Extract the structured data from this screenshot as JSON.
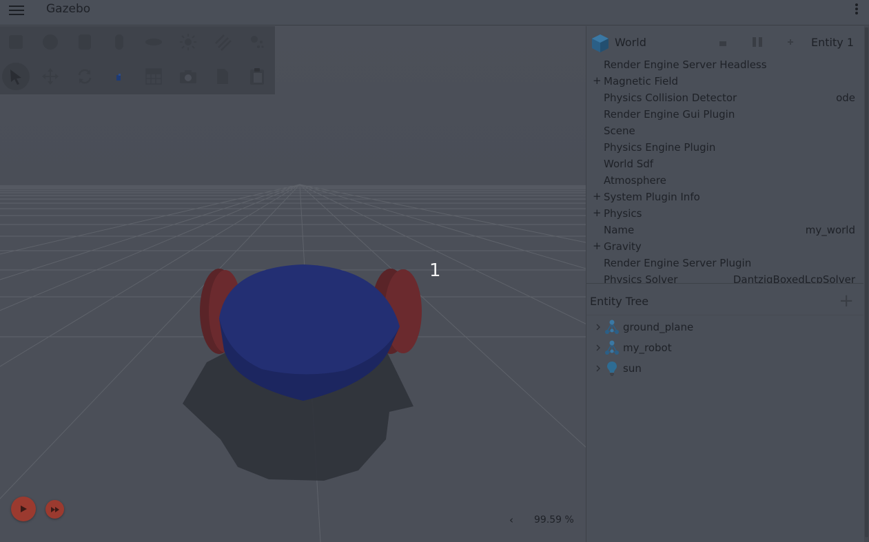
{
  "header": {
    "title": "Gazebo",
    "menu_icon": "hamburger-menu-icon",
    "more_icon": "more-vert-icon"
  },
  "toolbar": {
    "shape_tools": [
      "box",
      "sphere",
      "cylinder",
      "capsule",
      "ellipsoid",
      "directional-light",
      "spot-light",
      "point-light"
    ],
    "transform_tools": [
      "select",
      "translate",
      "rotate",
      "transform-control",
      "grid-config",
      "screenshot",
      "copy",
      "paste"
    ]
  },
  "viewport": {
    "overlay_text": "1",
    "real_time_factor": "99.59 %",
    "rtf_toggle": "‹"
  },
  "component_inspector": {
    "entity_name": "World",
    "entity_label": "Entity 1",
    "rows": [
      {
        "label": "Render Engine Server Headless",
        "expandable": false,
        "value": ""
      },
      {
        "label": "Magnetic Field",
        "expandable": true,
        "value": ""
      },
      {
        "label": "Physics Collision Detector",
        "expandable": false,
        "value": "ode"
      },
      {
        "label": "Render Engine Gui Plugin",
        "expandable": false,
        "value": ""
      },
      {
        "label": "Scene",
        "expandable": false,
        "value": ""
      },
      {
        "label": "Physics Engine Plugin",
        "expandable": false,
        "value": ""
      },
      {
        "label": "World Sdf",
        "expandable": false,
        "value": ""
      },
      {
        "label": "Atmosphere",
        "expandable": false,
        "value": ""
      },
      {
        "label": "System Plugin Info",
        "expandable": true,
        "value": ""
      },
      {
        "label": "Physics",
        "expandable": true,
        "value": ""
      },
      {
        "label": "Name",
        "expandable": false,
        "value": "my_world"
      },
      {
        "label": "Gravity",
        "expandable": true,
        "value": ""
      },
      {
        "label": "Render Engine Server Plugin",
        "expandable": false,
        "value": ""
      },
      {
        "label": "Physics Solver",
        "expandable": false,
        "value": "DantzigBoxedLcpSolver"
      }
    ]
  },
  "entity_tree": {
    "title": "Entity Tree",
    "add_label": "+",
    "items": [
      {
        "label": "ground_plane",
        "icon": "model-icon"
      },
      {
        "label": "my_robot",
        "icon": "model-icon"
      },
      {
        "label": "sun",
        "icon": "light-bulb-icon"
      }
    ]
  },
  "colors": {
    "background": "#4b4f58",
    "robot_body": "#232f73",
    "robot_wheels": "#6b2a2e",
    "play_button": "#9b3a2f"
  }
}
